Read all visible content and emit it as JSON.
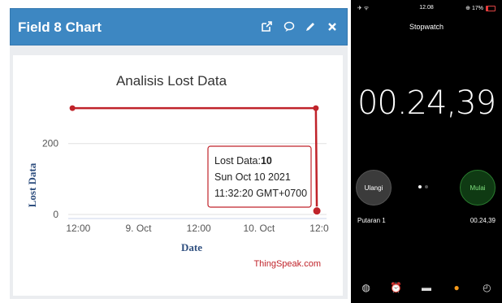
{
  "widget": {
    "title": "Field 8 Chart",
    "icons": [
      "external-link-icon",
      "comment-icon",
      "edit-icon",
      "close-icon"
    ]
  },
  "chart": {
    "title": "Analisis Lost Data",
    "ylabel": "Lost Data",
    "xlabel": "Date",
    "credits": "ThingSpeak.com",
    "tooltip": {
      "label": "Lost Data:",
      "value": "10",
      "date": "Sun Oct 10 2021",
      "time": "11:32:20 GMT+0700"
    },
    "line_color": "#c0232a"
  },
  "chart_data": {
    "type": "line",
    "title": "Analisis Lost Data",
    "xlabel": "Date",
    "ylabel": "Lost Data",
    "x_ticks": [
      "12:00",
      "9. Oct",
      "12:00",
      "10. Oct",
      "12:0"
    ],
    "y_ticks": [
      0,
      200
    ],
    "ylim": [
      0,
      330
    ],
    "series": [
      {
        "x": [
          "2021-10-08 10:50",
          "2021-10-10 11:20",
          "2021-10-10 11:32"
        ],
        "y": [
          300,
          300,
          10
        ]
      }
    ]
  },
  "phone": {
    "status": {
      "left": "✈ ᯤ",
      "time": "12.08",
      "right": "⊕ 17%"
    },
    "title": "Stopwatch",
    "time": "00.24,39",
    "lap_button": "Ulangi",
    "start_button": "Mulai",
    "lap_label": "Putaran 1",
    "lap_time": "00.24,39",
    "tabs": [
      {
        "name": "tab-world-clock",
        "icon": "globe-icon",
        "glyph": "◍"
      },
      {
        "name": "tab-alarm",
        "icon": "alarm-icon",
        "glyph": "⏰"
      },
      {
        "name": "tab-bedtime",
        "icon": "bed-icon",
        "glyph": "▬"
      },
      {
        "name": "tab-stopwatch",
        "icon": "stopwatch-icon",
        "glyph": "●",
        "active": true
      },
      {
        "name": "tab-timer",
        "icon": "timer-icon",
        "glyph": "◴"
      }
    ],
    "accent": "#f59a1b",
    "start_color": "#7ee07e"
  }
}
